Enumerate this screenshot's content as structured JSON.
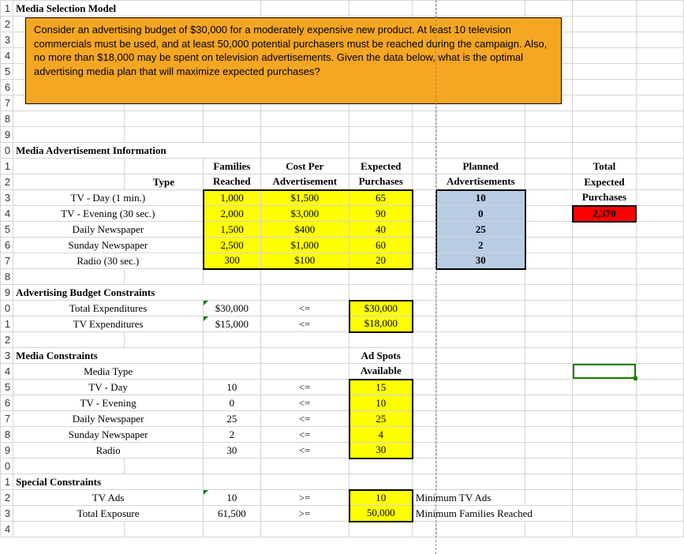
{
  "title": "Media Selection Model",
  "note_text": "Consider an advertising budget of $30,000 for a moderately expensive new product.  At least 10 television commercials must be used, and at least 50,000 potential purchasers must be reached during the campaign.  Also, no more than $18,000 may be spent on television advertisements.  Given the data below, what is the optimal advertising media plan that will maximize expected purchases?",
  "sec_media_info": "Media Advertisement Information",
  "hdr": {
    "type": "Type",
    "families1": "Families",
    "families2": "Reached",
    "cost1": "Cost Per",
    "cost2": "Advertisement",
    "exp1": "Expected",
    "exp2": "Purchases",
    "planned1": "Planned",
    "planned2": "Advertisements",
    "total1": "Total",
    "total2": "Expected",
    "total3": "Purchases"
  },
  "media": [
    {
      "type": "TV - Day (1 min.)",
      "families": "1,000",
      "cost": "$1,500",
      "exp": "65",
      "planned": "10"
    },
    {
      "type": "TV - Evening (30 sec.)",
      "families": "2,000",
      "cost": "$3,000",
      "exp": "90",
      "planned": "0"
    },
    {
      "type": "Daily Newspaper",
      "families": "1,500",
      "cost": "$400",
      "exp": "40",
      "planned": "25"
    },
    {
      "type": "Sunday Newspaper",
      "families": "2,500",
      "cost": "$1,000",
      "exp": "60",
      "planned": "2"
    },
    {
      "type": "Radio (30 sec.)",
      "families": "300",
      "cost": "$100",
      "exp": "20",
      "planned": "30"
    }
  ],
  "total_expected_purchases": "2,370",
  "sec_budget": "Advertising Budget Constraints",
  "budget": [
    {
      "label": "Total Expenditures",
      "val": "$30,000",
      "op": "<=",
      "limit": "$30,000"
    },
    {
      "label": "TV Expenditures",
      "val": "$15,000",
      "op": "<=",
      "limit": "$18,000"
    }
  ],
  "sec_media_constraints": "Media Constraints",
  "mc_hdr1": "Ad Spots",
  "mc_hdr2": "Available",
  "mc_label": "Media Type",
  "mc": [
    {
      "type": "TV - Day",
      "val": "10",
      "op": "<=",
      "limit": "15"
    },
    {
      "type": "TV - Evening",
      "val": "0",
      "op": "<=",
      "limit": "10"
    },
    {
      "type": "Daily Newspaper",
      "val": "25",
      "op": "<=",
      "limit": "25"
    },
    {
      "type": "Sunday Newspaper",
      "val": "2",
      "op": "<=",
      "limit": "4"
    },
    {
      "type": "Radio",
      "val": "30",
      "op": "<=",
      "limit": "30"
    }
  ],
  "sec_special": "Special Constraints",
  "sp": [
    {
      "label": "TV Ads",
      "val": "10",
      "op": ">=",
      "limit": "10",
      "note": "Minimum TV Ads"
    },
    {
      "label": "Total Exposure",
      "val": "61,500",
      "op": ">=",
      "limit": "50,000",
      "note": "Minimum Families Reached"
    }
  ],
  "rows": [
    "1",
    "2",
    "3",
    "4",
    "5",
    "6",
    "7",
    "8",
    "9",
    "0",
    "1",
    "2",
    "3",
    "4",
    "5",
    "6",
    "7",
    "8",
    "9",
    "0",
    "1",
    "2",
    "3",
    "4",
    "5",
    "6",
    "7",
    "8",
    "9",
    "0",
    "1",
    "2",
    "3",
    "4"
  ]
}
